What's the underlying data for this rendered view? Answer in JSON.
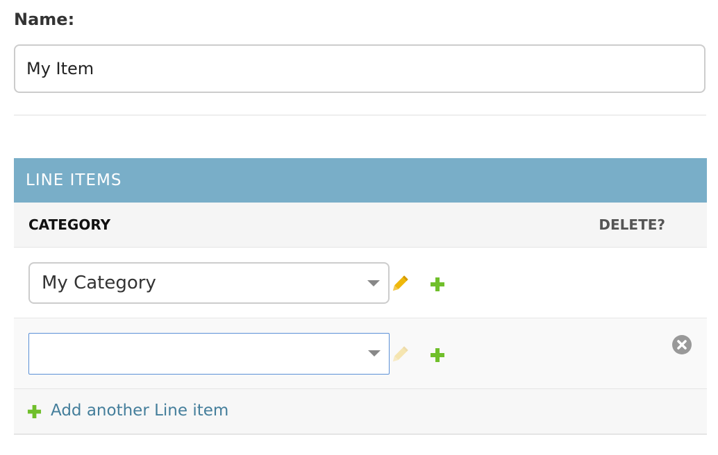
{
  "form": {
    "name_label": "Name:",
    "name_value": "My Item"
  },
  "inline": {
    "title": "LINE ITEMS",
    "headers": {
      "category": "CATEGORY",
      "delete": "DELETE?"
    },
    "rows": [
      {
        "category": "My Category",
        "focused": false,
        "has_delete": false,
        "edit_enabled": true
      },
      {
        "category": "",
        "focused": true,
        "has_delete": true,
        "edit_enabled": false
      }
    ],
    "add_link": "Add another Line item"
  },
  "colors": {
    "header_bg": "#79aec8",
    "link": "#447e9b",
    "add_icon": "#70bf2b",
    "edit_icon": "#efb80b",
    "delete_icon": "#999999",
    "focus_border": "#5a8fd6"
  },
  "icons": {
    "edit": "pencil-icon",
    "add": "plus-icon",
    "delete": "delete-circle-icon",
    "dropdown": "chevron-down-icon"
  }
}
